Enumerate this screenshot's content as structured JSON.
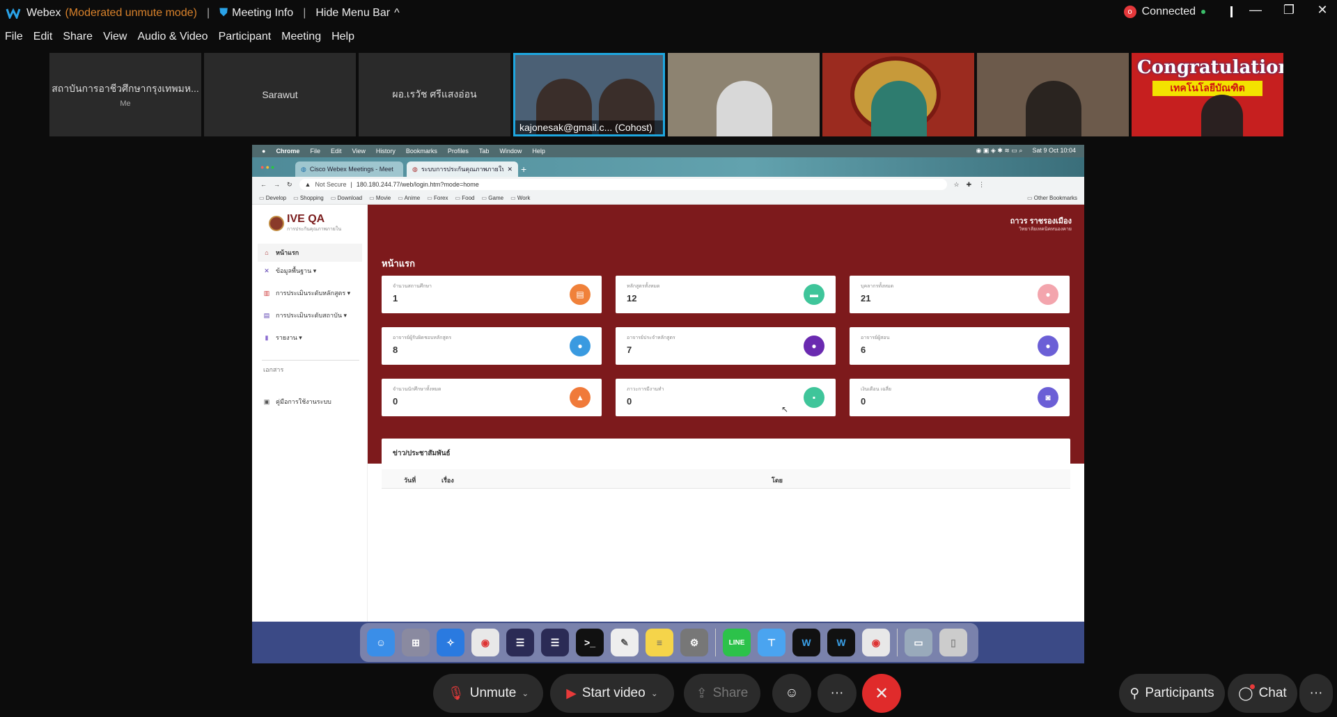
{
  "titlebar": {
    "app": "Webex",
    "mode": "(Moderated unmute mode)",
    "meeting_info": "Meeting Info",
    "hide_menu": "Hide Menu Bar",
    "connection": "Connected"
  },
  "menu": [
    "File",
    "Edit",
    "Share",
    "View",
    "Audio & Video",
    "Participant",
    "Meeting",
    "Help"
  ],
  "participants_strip": {
    "t1_name": "สถาบันการอาชีวศึกษากรุงเทพมห...",
    "t1_me": "Me",
    "t2_name": "Sarawut",
    "t3_name": "ผอ.เรวัช ศรีแสงอ่อน",
    "t4_cap": "kajonesak@gmail.c...  (Cohost)",
    "t8_text": "Congratulations",
    "t8_tag": "เทคโนโลยีบัณฑิต"
  },
  "mac": {
    "apple": "",
    "app": "Chrome",
    "menus": [
      "File",
      "Edit",
      "View",
      "History",
      "Bookmarks",
      "Profiles",
      "Tab",
      "Window",
      "Help"
    ],
    "clock": "Sat 9 Oct  10:04"
  },
  "browser": {
    "tab1": "Cisco Webex Meetings - Meet",
    "tab2": "ระบบการประกันคุณภาพภายในสถ",
    "not_secure": "Not Secure",
    "url": "180.180.244.77/web/login.htm?mode=home",
    "bookmarks": [
      "Develop",
      "Shopping",
      "Download",
      "Movie",
      "Anime",
      "Forex",
      "Food",
      "Game",
      "Work"
    ],
    "other_bookmarks": "Other Bookmarks"
  },
  "site": {
    "logo_title": "IVE QA",
    "logo_sub": "การประกันคุณภาพภายใน",
    "nav": {
      "home": "หน้าแรก",
      "basic": "ข้อมูลพื้นฐาน ▾",
      "course": "การประเมินระดับหลักสูตร ▾",
      "inst": "การประเมินระดับสถาบัน ▾",
      "report": "รายงาน ▾",
      "section": "เอกสาร",
      "manual": "คู่มือการใช้งานระบบ"
    },
    "user_name": "ถาวร ราชรองเมือง",
    "user_org": "วิทยาลัยเทคนิคหนองคาย",
    "page_title": "หน้าแรก",
    "cards": [
      {
        "label": "จำนวนสถานศึกษา",
        "value": "1",
        "color": "#f0813a"
      },
      {
        "label": "หลักสูตรทั้งหมด",
        "value": "12",
        "color": "#3fc59a"
      },
      {
        "label": "บุคลากรทั้งหมด",
        "value": "21",
        "color": "#f3a5ad"
      },
      {
        "label": "อาจารย์ผู้รับผิดชอบหลักสูตร",
        "value": "8",
        "color": "#3a9ae0"
      },
      {
        "label": "อาจารย์ประจำหลักสูตร",
        "value": "7",
        "color": "#6a2ab0"
      },
      {
        "label": "อาจารย์ผู้สอน",
        "value": "6",
        "color": "#6b5fd6"
      },
      {
        "label": "จำนวนนักศึกษาทั้งหมด",
        "value": "0",
        "color": "#f07a3a"
      },
      {
        "label": "ภาวะการมีงานทำ",
        "value": "0",
        "color": "#3fc59a"
      },
      {
        "label": "เงินเดือน เฉลี่ย",
        "value": "0",
        "color": "#6b5fd6"
      }
    ],
    "news_title": "ข่าว/ประชาสัมพันธ์",
    "news_cols": {
      "date": "วันที่",
      "subject": "เรื่อง",
      "by": "โดย"
    }
  },
  "controls": {
    "unmute": "Unmute",
    "start_video": "Start video",
    "share": "Share",
    "participants": "Participants",
    "chat": "Chat"
  }
}
